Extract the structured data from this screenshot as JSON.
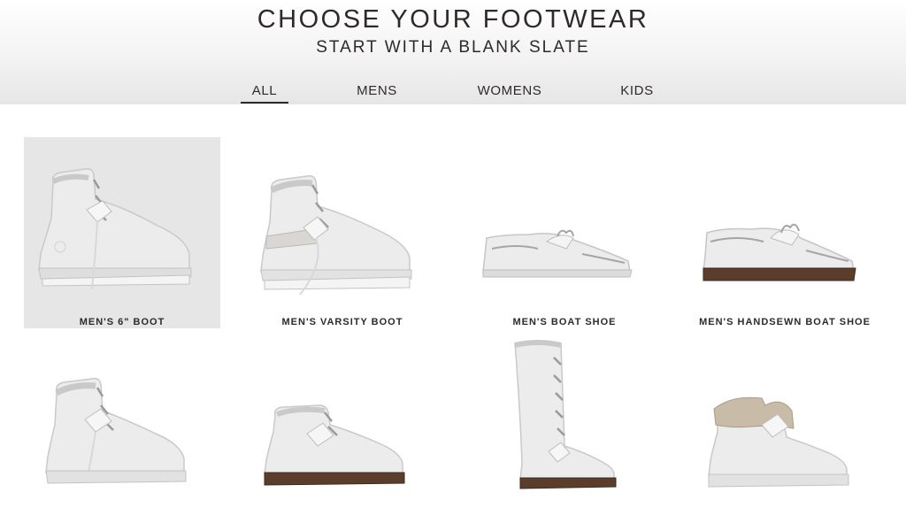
{
  "header": {
    "title": "CHOOSE YOUR FOOTWEAR",
    "subtitle": "START WITH A BLANK SLATE"
  },
  "tabs": [
    {
      "label": "ALL",
      "active": true
    },
    {
      "label": "MENS",
      "active": false
    },
    {
      "label": "WOMENS",
      "active": false
    },
    {
      "label": "KIDS",
      "active": false
    }
  ],
  "products": [
    {
      "label": "MEN'S 6\" BOOT",
      "selected": true,
      "icon": "white-6-inch-boot-icon"
    },
    {
      "label": "MEN'S VARSITY BOOT",
      "selected": false,
      "icon": "white-varsity-boot-icon"
    },
    {
      "label": "MEN'S BOAT SHOE",
      "selected": false,
      "icon": "white-boat-shoe-icon"
    },
    {
      "label": "MEN'S HANDSEWN BOAT SHOE",
      "selected": false,
      "icon": "white-handsewn-boat-shoe-icon"
    },
    {
      "label": "",
      "selected": false,
      "icon": "white-kids-boot-icon"
    },
    {
      "label": "",
      "selected": false,
      "icon": "white-chukka-boot-icon"
    },
    {
      "label": "",
      "selected": false,
      "icon": "white-tall-boot-icon"
    },
    {
      "label": "",
      "selected": false,
      "icon": "white-roll-top-boot-icon"
    }
  ],
  "colors": {
    "shoe_white": "#ececec",
    "shoe_shadow": "#cfcfcf",
    "dark_sole": "#5a3e2b",
    "tan_lining": "#c8bca8",
    "selected_bg": "#e6e6e6"
  }
}
